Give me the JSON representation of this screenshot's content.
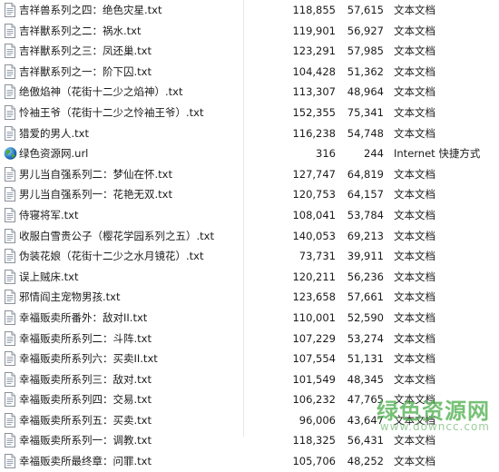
{
  "files": [
    {
      "name": "吉祥兽系列之四：绝色灾星.txt",
      "packed": "118,855",
      "size": "57,615",
      "type": "文本文档",
      "icon": "text-file-icon"
    },
    {
      "name": "吉祥獸系列之二：祸水.txt",
      "packed": "119,901",
      "size": "56,927",
      "type": "文本文档",
      "icon": "text-file-icon"
    },
    {
      "name": "吉祥獸系列之三：凤还巢.txt",
      "packed": "123,291",
      "size": "57,985",
      "type": "文本文档",
      "icon": "text-file-icon"
    },
    {
      "name": "吉祥獸系列之一：阶下囚.txt",
      "packed": "104,428",
      "size": "51,362",
      "type": "文本文档",
      "icon": "text-file-icon"
    },
    {
      "name": "绝傲焰神（花街十二少之焰神）.txt",
      "packed": "113,307",
      "size": "48,964",
      "type": "文本文档",
      "icon": "text-file-icon"
    },
    {
      "name": "怜袖王爷（花街十二少之怜袖王爷）.txt",
      "packed": "152,355",
      "size": "75,341",
      "type": "文本文档",
      "icon": "text-file-icon"
    },
    {
      "name": "猎爱的男人.txt",
      "packed": "116,238",
      "size": "54,748",
      "type": "文本文档",
      "icon": "text-file-icon"
    },
    {
      "name": "绿色资源网.url",
      "packed": "316",
      "size": "244",
      "type": "Internet 快捷方式",
      "icon": "internet-shortcut-globe-icon"
    },
    {
      "name": "男儿当自强系列二：梦仙在怀.txt",
      "packed": "127,747",
      "size": "64,819",
      "type": "文本文档",
      "icon": "text-file-icon"
    },
    {
      "name": "男儿当自强系列一：花艳无双.txt",
      "packed": "120,753",
      "size": "64,157",
      "type": "文本文档",
      "icon": "text-file-icon"
    },
    {
      "name": "侍寝将军.txt",
      "packed": "108,041",
      "size": "53,784",
      "type": "文本文档",
      "icon": "text-file-icon"
    },
    {
      "name": "收服白雪贵公子（樱花学园系列之五）.txt",
      "packed": "140,053",
      "size": "69,213",
      "type": "文本文档",
      "icon": "text-file-icon"
    },
    {
      "name": "伪装花娘（花街十二少之水月镜花）.txt",
      "packed": "73,731",
      "size": "39,911",
      "type": "文本文档",
      "icon": "text-file-icon"
    },
    {
      "name": "误上贼床.txt",
      "packed": "120,211",
      "size": "56,236",
      "type": "文本文档",
      "icon": "text-file-icon"
    },
    {
      "name": "邪情阎主宠物男孩.txt",
      "packed": "123,658",
      "size": "57,661",
      "type": "文本文档",
      "icon": "text-file-icon"
    },
    {
      "name": "幸福贩卖所番外：敌对II.txt",
      "packed": "110,001",
      "size": "52,590",
      "type": "文本文档",
      "icon": "text-file-icon"
    },
    {
      "name": "幸福贩卖所系列二：斗阵.txt",
      "packed": "107,229",
      "size": "53,274",
      "type": "文本文档",
      "icon": "text-file-icon"
    },
    {
      "name": "幸福贩卖所系列六：买卖II.txt",
      "packed": "107,554",
      "size": "51,131",
      "type": "文本文档",
      "icon": "text-file-icon"
    },
    {
      "name": "幸福贩卖所系列三：敌对.txt",
      "packed": "101,549",
      "size": "48,345",
      "type": "文本文档",
      "icon": "text-file-icon"
    },
    {
      "name": "幸福贩卖所系列四：交易.txt",
      "packed": "106,232",
      "size": "47,765",
      "type": "文本文档",
      "icon": "text-file-icon"
    },
    {
      "name": "幸福贩卖所系列五：买卖.txt",
      "packed": "96,006",
      "size": "43,647",
      "type": "文本文档",
      "icon": "text-file-icon"
    },
    {
      "name": "幸福贩卖所系列一：调教.txt",
      "packed": "118,325",
      "size": "56,431",
      "type": "文本文档",
      "icon": "text-file-icon"
    },
    {
      "name": "幸福贩卖所最终章：问罪.txt",
      "packed": "105,706",
      "size": "48,252",
      "type": "文本文档",
      "icon": "text-file-icon"
    }
  ],
  "watermark": {
    "text": "绿色资源网",
    "url": "www.downcc.com"
  }
}
